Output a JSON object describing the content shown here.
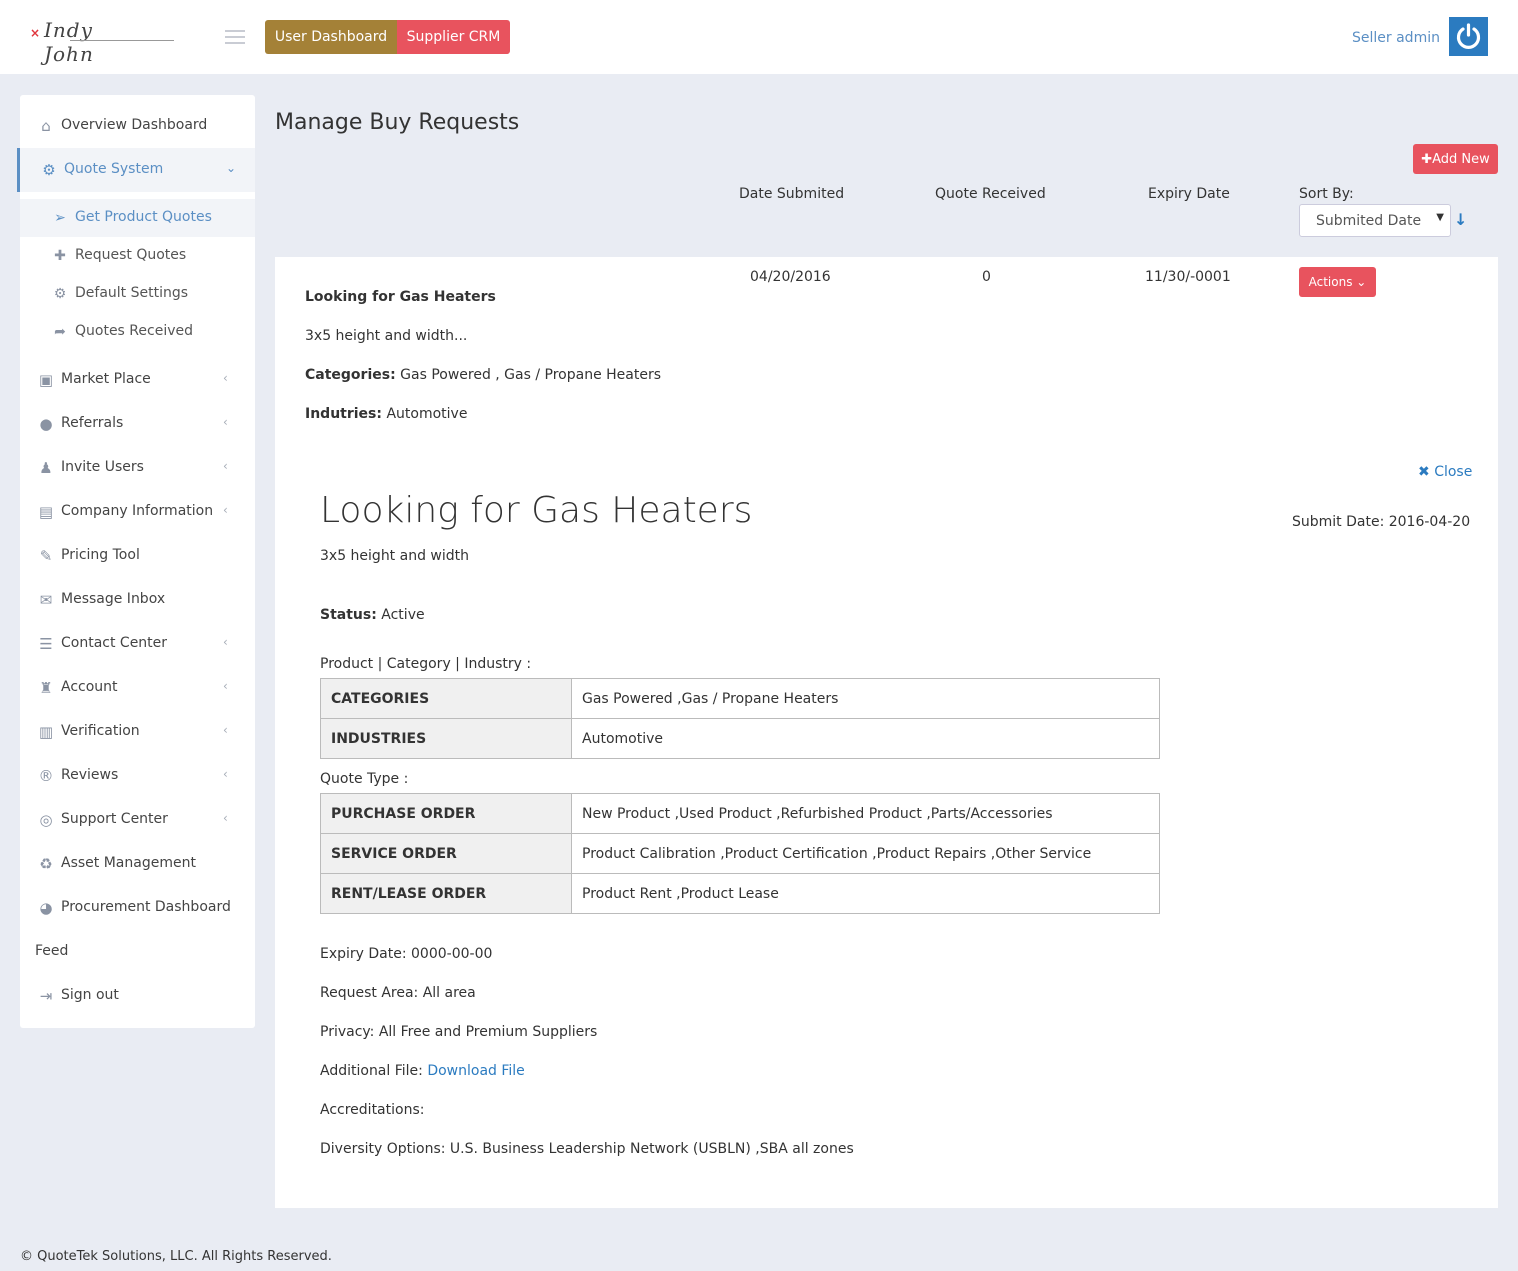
{
  "header": {
    "logo_text": "Indy John",
    "user_dashboard_label": "User Dashboard",
    "supplier_crm_label": "Supplier CRM",
    "seller_name": "Seller admin"
  },
  "sidebar": {
    "items": [
      {
        "label": "Overview Dashboard",
        "icon": "home-icon"
      },
      {
        "label": "Quote System",
        "icon": "cogs-icon"
      },
      {
        "label": "Market Place",
        "icon": "money-icon"
      },
      {
        "label": "Referrals",
        "icon": "users-icon"
      },
      {
        "label": "Invite Users",
        "icon": "user-plus-icon"
      },
      {
        "label": "Company Information",
        "icon": "archive-icon"
      },
      {
        "label": "Pricing Tool",
        "icon": "wrench-icon"
      },
      {
        "label": "Message Inbox",
        "icon": "envelope-icon"
      },
      {
        "label": "Contact Center",
        "icon": "list-icon"
      },
      {
        "label": "Account",
        "icon": "user-secret-icon"
      },
      {
        "label": "Verification",
        "icon": "file-text-icon"
      },
      {
        "label": "Reviews",
        "icon": "registered-icon"
      },
      {
        "label": "Support Center",
        "icon": "life-ring-icon"
      },
      {
        "label": "Asset Management",
        "icon": "recycle-icon"
      },
      {
        "label": "Procurement Dashboard",
        "icon": "pie-chart-icon"
      },
      {
        "label": "Feed",
        "icon": ""
      },
      {
        "label": "Sign out",
        "icon": "sign-out-icon"
      }
    ],
    "sub_items": [
      {
        "label": "Get Product Quotes",
        "icon": "paper-plane-icon"
      },
      {
        "label": "Request Quotes",
        "icon": "plus-icon"
      },
      {
        "label": "Default Settings",
        "icon": "cogs-icon"
      },
      {
        "label": "Quotes Received",
        "icon": "share-icon"
      }
    ]
  },
  "main": {
    "title": "Manage Buy Requests",
    "add_new_label": "Add New",
    "columns": {
      "date_submitted": "Date Submited",
      "quote_received": "Quote Received",
      "expiry_date": "Expiry Date",
      "sort_by": "Sort By:"
    },
    "sort_select_value": "Submited Date",
    "row": {
      "title": "Looking for Gas Heaters",
      "summary": "3x5 height and width...",
      "categories_label": "Categories:",
      "categories_value": "Gas Powered , Gas / Propane Heaters",
      "industries_label": "Indutries:",
      "industries_value": "Automotive",
      "date_submitted": "04/20/2016",
      "quotes": "0",
      "expiry": "11/30/-0001",
      "actions_label": "Actions"
    },
    "detail": {
      "close_label": "Close",
      "title": "Looking for Gas Heaters",
      "submit_date": "Submit Date: 2016-04-20",
      "description": "3x5 height and width",
      "status_label": "Status:",
      "status_value": "Active",
      "pci_label": "Product | Category | Industry :",
      "pci_rows": [
        {
          "key": "CATEGORIES",
          "value": "Gas Powered ,Gas / Propane Heaters"
        },
        {
          "key": "INDUSTRIES",
          "value": "Automotive"
        }
      ],
      "quote_type_label": "Quote Type :",
      "quote_rows": [
        {
          "key": "PURCHASE ORDER",
          "value": "New Product ,Used Product ,Refurbished Product ,Parts/Accessories"
        },
        {
          "key": "SERVICE ORDER",
          "value": "Product Calibration ,Product Certification ,Product Repairs ,Other Service"
        },
        {
          "key": "RENT/LEASE ORDER",
          "value": "Product Rent ,Product Lease"
        }
      ],
      "expiry": "Expiry Date: 0000-00-00",
      "request_area": "Request Area: All area",
      "privacy": "Privacy: All Free and Premium Suppliers",
      "additional_file_label": "Additional File:",
      "download_link": "Download File",
      "accreditations": "Accreditations:",
      "diversity": "Diversity Options: U.S. Business Leadership Network (USBLN) ,SBA all zones"
    }
  },
  "footer": {
    "copyright": "© QuoteTek Solutions, LLC. All Rights Reserved."
  },
  "colors": {
    "gold": "#a48137",
    "red": "#e8535e",
    "blue": "#2b7bc0",
    "link_blue": "#5b8fc4"
  }
}
